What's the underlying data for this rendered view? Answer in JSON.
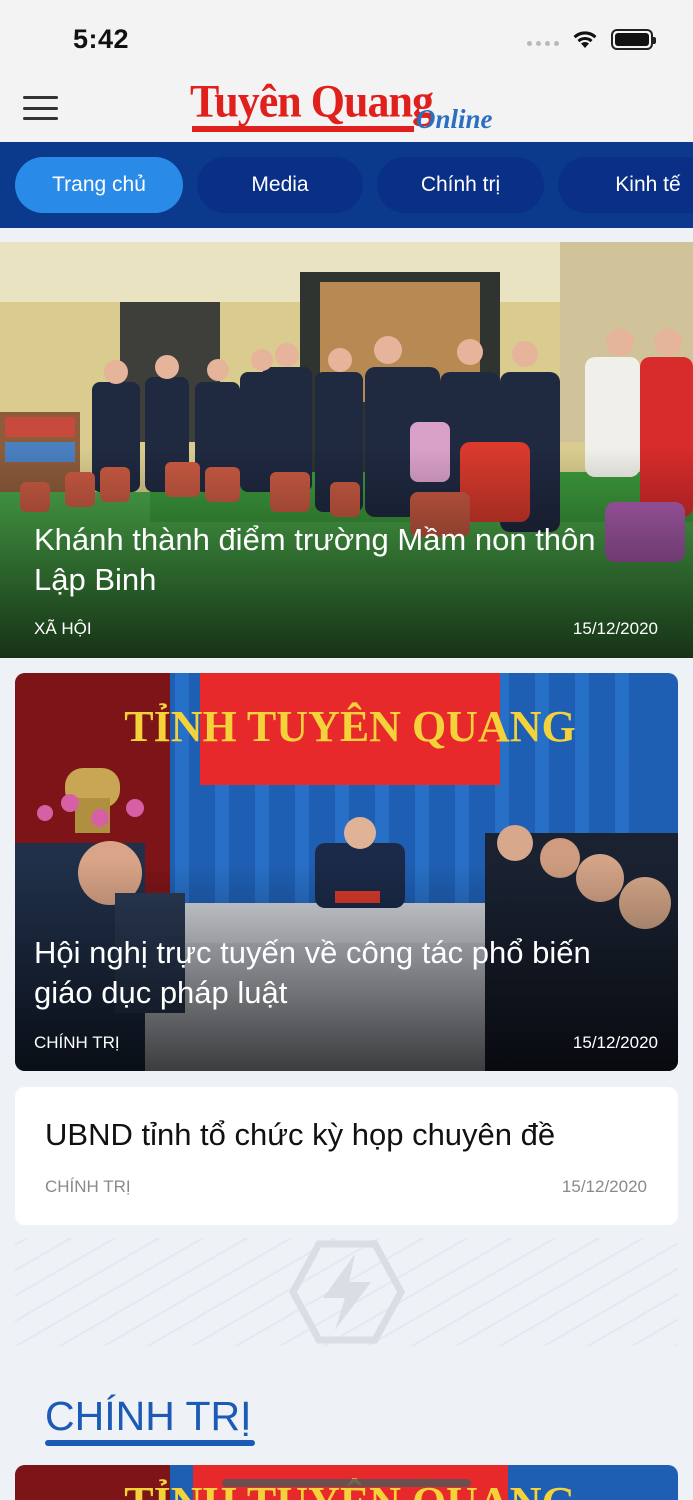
{
  "status": {
    "time": "5:42"
  },
  "header": {
    "logo_main": "Tuyên Quang",
    "logo_sub": "Online"
  },
  "tabs": [
    {
      "label": "Trang chủ",
      "active": true
    },
    {
      "label": "Media",
      "active": false
    },
    {
      "label": "Chính trị",
      "active": false
    },
    {
      "label": "Kinh tế",
      "active": false
    }
  ],
  "articles": [
    {
      "title": "Khánh thành điểm trường Mầm non thôn Lập Binh",
      "category": "XÃ HỘI",
      "date": "15/12/2020"
    },
    {
      "title": "Hội nghị trực tuyến về công tác phổ biến giáo dục pháp luật",
      "category": "CHÍNH TRỊ",
      "date": "15/12/2020",
      "banner_text": "TỈNH TUYÊN QUANG"
    },
    {
      "title": "UBND tỉnh tổ chức kỳ họp chuyên đề",
      "category": "CHÍNH TRỊ",
      "date": "15/12/2020"
    }
  ],
  "section": {
    "title": "CHÍNH TRỊ",
    "preview_banner_text": "TỈNH TUYÊN QUANG"
  },
  "colors": {
    "brand_red": "#e0201c",
    "nav_blue": "#0b3a8c",
    "active_tab": "#2a8ae8",
    "section_blue": "#1b5ab5"
  }
}
